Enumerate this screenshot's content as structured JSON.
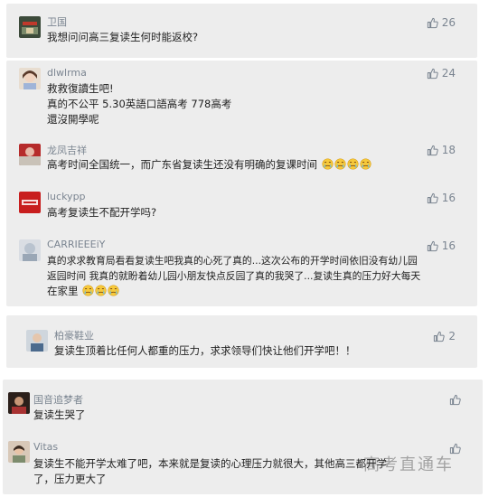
{
  "comments": [
    {
      "user": "卫国",
      "likes": "26",
      "lines": [
        "我想问问高三复读生何时能返校?"
      ]
    },
    {
      "user": "dlwlrma",
      "likes": "24",
      "lines": [
        "救救復讀生吧!",
        "真的不公平 5.30英語口語高考 778高考",
        "還沒開學呢"
      ]
    },
    {
      "user": "龙凤吉祥",
      "likes": "18",
      "lines": [
        "高考时间全国统一，而广东省复读生还没有明确的复课时间"
      ]
    },
    {
      "user": "luckypp",
      "likes": "16",
      "lines": [
        "高考复读生不配开学吗?"
      ]
    },
    {
      "user": "CARRIEEEiY",
      "likes": "16",
      "lines": [
        "真的求求教育局看看复读生吧我真的心死了真的...这次公布的开学时间依旧没有幼儿园",
        "返园时间 我真的就盼着幼儿园小朋友快点反园了真的我哭了...复读生真的压力好大每天",
        "在家里"
      ]
    },
    {
      "user": "柏豪鞋业",
      "likes": "2",
      "lines": [
        "复读生顶着比任何人都重的压力，求求领导们快让他们开学吧！！"
      ]
    },
    {
      "user": "国音追梦者",
      "likes": "",
      "lines": [
        "复读生哭了"
      ]
    },
    {
      "user": "Vitas",
      "likes": "",
      "lines": [
        "复读生不能开学太难了吧，本来就是复读的心理压力就很大，其他高三都开学",
        "了，压力更大了"
      ]
    }
  ],
  "watermark": "高考直通车",
  "colors": {
    "card_bg": "#ededed",
    "name": "#7b8591",
    "text": "#1f1f1f",
    "like": "#7b8591"
  },
  "icons": {
    "like": "thumbs-up-icon",
    "emoji": "crying-face-icon"
  }
}
